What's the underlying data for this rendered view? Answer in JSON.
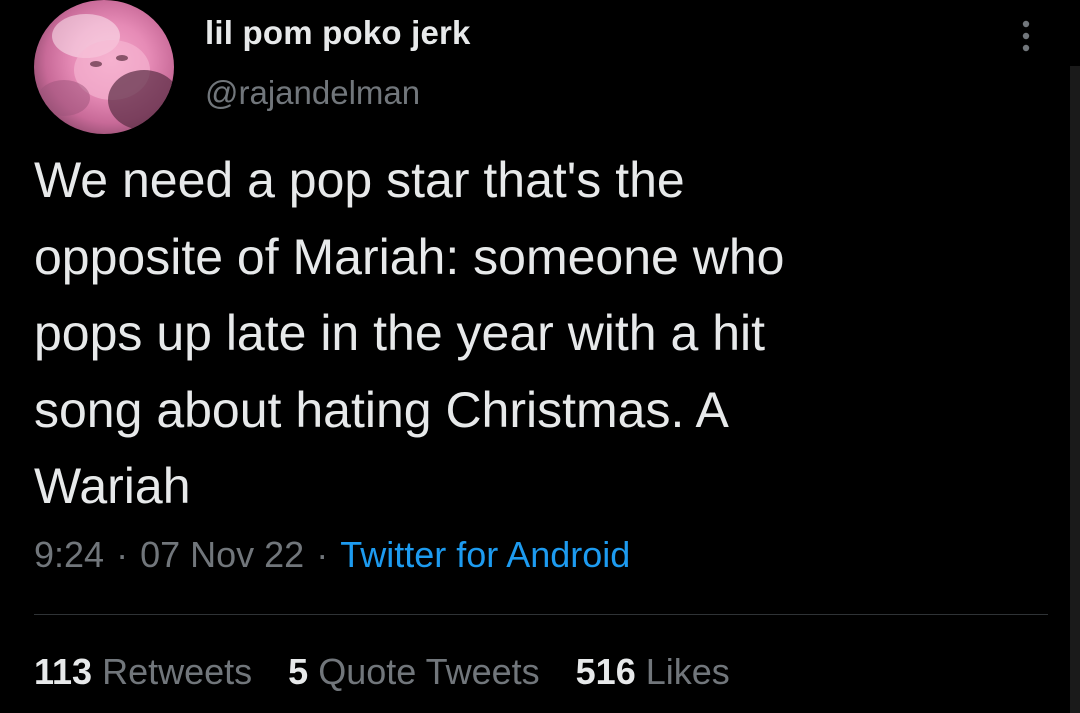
{
  "user": {
    "display_name": "lil pom poko jerk",
    "handle": "@rajandelman",
    "avatar_icon": "profile-photo"
  },
  "more_icon": "more-vertical-icon",
  "tweet": {
    "text": "We need a pop star that's the\nopposite of Mariah: someone who\npops up late in the year with a hit\nsong about hating Christmas. A\nWariah",
    "time": "9:24",
    "separator": "·",
    "date": "07 Nov 22",
    "source": "Twitter for Android"
  },
  "stats": {
    "retweets": {
      "count": "113",
      "label": "Retweets"
    },
    "quotes": {
      "count": "5",
      "label": "Quote Tweets"
    },
    "likes": {
      "count": "516",
      "label": "Likes"
    }
  },
  "colors": {
    "background": "#000000",
    "text": "#e7e9ea",
    "secondary": "#71767b",
    "link": "#1d9bf0",
    "divider": "#2f3336"
  }
}
